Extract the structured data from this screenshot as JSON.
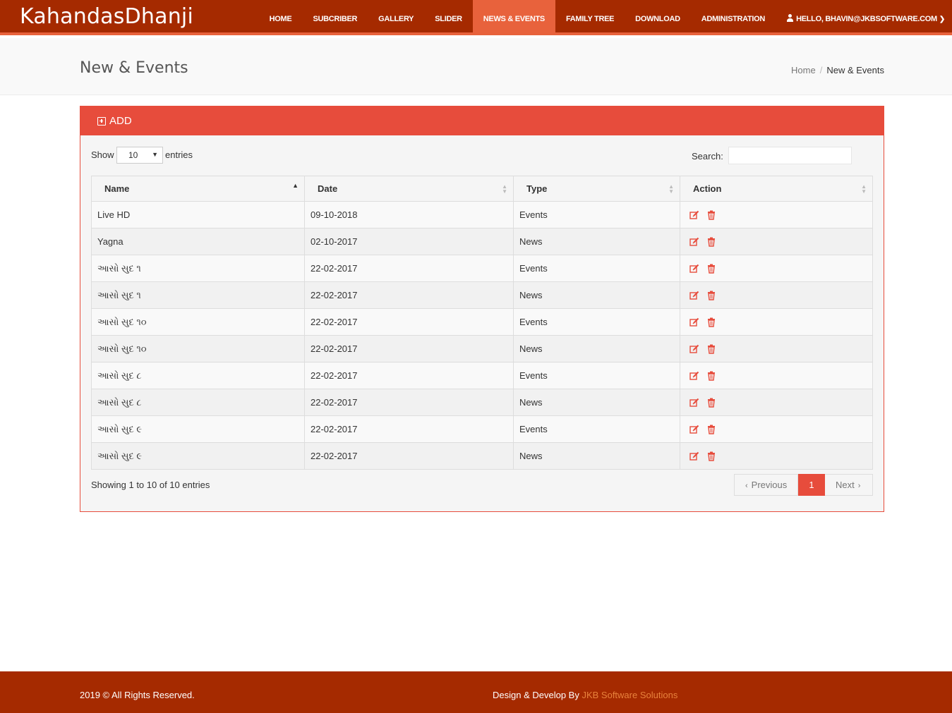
{
  "brand": "KahandasDhanji",
  "nav": {
    "items": [
      "HOME",
      "SUBCRIBER",
      "GALLERY",
      "SLIDER",
      "NEWS & EVENTS",
      "FAMILY TREE",
      "DOWNLOAD",
      "ADMINISTRATION"
    ],
    "active": "NEWS & EVENTS",
    "user_label": "HELLO, BHAVIN@JKBSOFTWARE.COM"
  },
  "page": {
    "title": "New & Events",
    "breadcrumb": [
      "Home",
      "New & Events"
    ]
  },
  "panel": {
    "add_label": "ADD",
    "show_label": "Show",
    "length_value": "10",
    "entries_label": "entries",
    "search_label": "Search:",
    "search_value": ""
  },
  "table": {
    "columns": [
      "Name",
      "Date",
      "Type",
      "Action"
    ],
    "rows": [
      {
        "name": "Live HD",
        "date": "09-10-2018",
        "type": "Events"
      },
      {
        "name": "Yagna",
        "date": "02-10-2017",
        "type": "News"
      },
      {
        "name": "આસો સુદ ૧",
        "date": "22-02-2017",
        "type": "Events"
      },
      {
        "name": "આસો સુદ ૧",
        "date": "22-02-2017",
        "type": "News"
      },
      {
        "name": "આસો સુદ ૧૦",
        "date": "22-02-2017",
        "type": "Events"
      },
      {
        "name": "આસો સુદ ૧૦",
        "date": "22-02-2017",
        "type": "News"
      },
      {
        "name": "આસો સુદ ૮",
        "date": "22-02-2017",
        "type": "Events"
      },
      {
        "name": "આસો સુદ ૮",
        "date": "22-02-2017",
        "type": "News"
      },
      {
        "name": "આસો સુદ ૯",
        "date": "22-02-2017",
        "type": "Events"
      },
      {
        "name": "આસો સુદ ૯",
        "date": "22-02-2017",
        "type": "News"
      }
    ],
    "action_icons": [
      "edit-icon",
      "delete-icon"
    ]
  },
  "pagination": {
    "info": "Showing 1 to 10 of 10 entries",
    "previous": "Previous",
    "current": "1",
    "next": "Next"
  },
  "footer": {
    "copyright": "2019 © All Rights Reserved.",
    "credit_prefix": "Design & Develop By",
    "credit_link": "JKB Software Solutions"
  },
  "colors": {
    "header_bg": "#a52a00",
    "accent": "#e8623c",
    "panel_red": "#e74c3c"
  }
}
